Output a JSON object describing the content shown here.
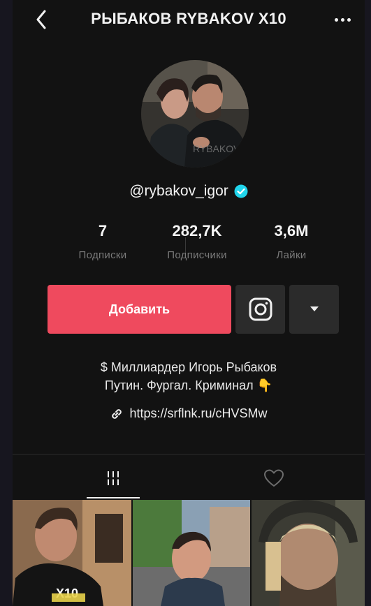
{
  "header": {
    "title": "РЫБАКОВ RYBAKOV X10",
    "back_icon": "back-arrow-icon",
    "more_icon": "more-dots-icon"
  },
  "profile": {
    "avatar_watermark": "RYBAKOV",
    "handle": "@rybakov_igor",
    "verified": true
  },
  "stats": [
    {
      "value": "7",
      "label": "Подписки"
    },
    {
      "value": "282,7K",
      "label": "Подписчики"
    },
    {
      "value": "3,6M",
      "label": "Лайки"
    }
  ],
  "actions": {
    "follow_label": "Добавить",
    "instagram_icon": "instagram-icon",
    "dropdown_icon": "caret-down-icon"
  },
  "bio": {
    "line1": "$ Миллиардер Игорь Рыбаков",
    "line2": "Путин. Фургал. Криминал 👇",
    "link": "https://srflnk.ru/cHVSMw"
  },
  "tabs": [
    {
      "name": "videos",
      "icon": "grid-icon",
      "active": true
    },
    {
      "name": "liked",
      "icon": "heart-icon",
      "active": false
    }
  ],
  "videos": [
    {
      "caption": "X10",
      "badge": ""
    },
    {
      "caption": "",
      "badge": ""
    },
    {
      "caption": "",
      "badge": ""
    }
  ],
  "colors": {
    "accent": "#ef4a5e",
    "background": "#121212",
    "verified": "#20d5ec",
    "button_secondary": "#2b2b2b"
  }
}
